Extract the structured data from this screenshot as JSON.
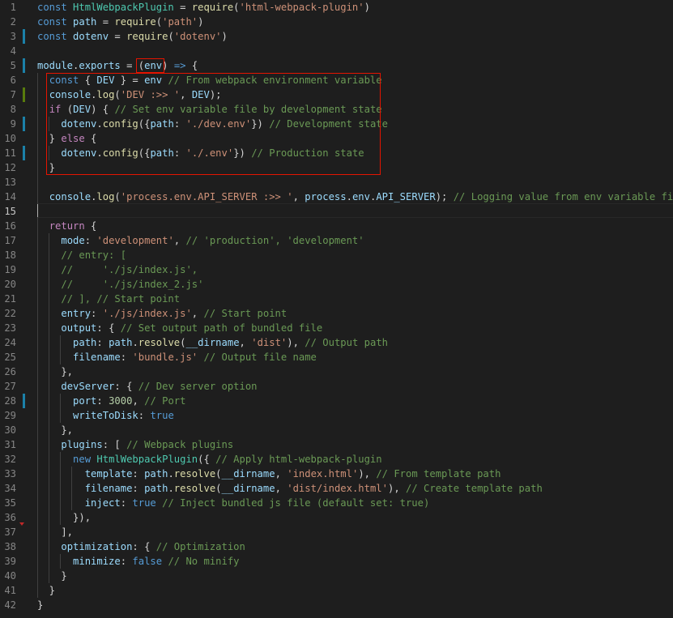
{
  "colors": {
    "background": "#1e1e1e",
    "line_number": "#858585",
    "keyword": "#569cd6",
    "control": "#c586c0",
    "variable": "#9cdcfe",
    "class": "#4ec9b0",
    "function": "#dcdcaa",
    "string": "#ce9178",
    "number": "#b5cea8",
    "comment": "#6a9955",
    "highlight_box": "#e51400",
    "gutter_modified": "#1b81a8",
    "gutter_added": "#587c0c"
  },
  "editor": {
    "active_line": 15,
    "lines": [
      {
        "n": "1",
        "tokens": [
          [
            "kw",
            "const"
          ],
          [
            "plain",
            " "
          ],
          [
            "cls",
            "HtmlWebpackPlugin"
          ],
          [
            "plain",
            " = "
          ],
          [
            "fn",
            "require"
          ],
          [
            "plain",
            "("
          ],
          [
            "str",
            "'html-webpack-plugin'"
          ],
          [
            "plain",
            ")"
          ]
        ]
      },
      {
        "n": "2",
        "tokens": [
          [
            "kw",
            "const"
          ],
          [
            "plain",
            " "
          ],
          [
            "var",
            "path"
          ],
          [
            "plain",
            " = "
          ],
          [
            "fn",
            "require"
          ],
          [
            "plain",
            "("
          ],
          [
            "str",
            "'path'"
          ],
          [
            "plain",
            ")"
          ]
        ]
      },
      {
        "n": "3",
        "gutter": "modified",
        "tokens": [
          [
            "kw",
            "const"
          ],
          [
            "plain",
            " "
          ],
          [
            "var",
            "dotenv"
          ],
          [
            "plain",
            " = "
          ],
          [
            "fn",
            "require"
          ],
          [
            "plain",
            "("
          ],
          [
            "str",
            "'dotenv'"
          ],
          [
            "plain",
            ")"
          ]
        ]
      },
      {
        "n": "4",
        "tokens": []
      },
      {
        "n": "5",
        "gutter": "modified",
        "tokens": [
          [
            "var",
            "module"
          ],
          [
            "plain",
            "."
          ],
          [
            "var",
            "exports"
          ],
          [
            "plain",
            " = "
          ],
          [
            "plain",
            "("
          ],
          [
            "var",
            "env"
          ],
          [
            "plain",
            ")"
          ],
          [
            "plain",
            " "
          ],
          [
            "kw",
            "=>"
          ],
          [
            "plain",
            " {"
          ]
        ]
      },
      {
        "n": "6",
        "tokens": [
          [
            "plain",
            "  "
          ],
          [
            "kw",
            "const"
          ],
          [
            "plain",
            " { "
          ],
          [
            "var",
            "DEV"
          ],
          [
            "plain",
            " } = "
          ],
          [
            "var",
            "env"
          ],
          [
            "plain",
            " "
          ],
          [
            "com",
            "// From webpack environment variable"
          ]
        ]
      },
      {
        "n": "7",
        "gutter": "added",
        "tokens": [
          [
            "plain",
            "  "
          ],
          [
            "var",
            "console"
          ],
          [
            "plain",
            "."
          ],
          [
            "fn",
            "log"
          ],
          [
            "plain",
            "("
          ],
          [
            "str",
            "'DEV :>> '"
          ],
          [
            "plain",
            ", "
          ],
          [
            "var",
            "DEV"
          ],
          [
            "plain",
            ");"
          ]
        ]
      },
      {
        "n": "8",
        "tokens": [
          [
            "plain",
            "  "
          ],
          [
            "ctl",
            "if"
          ],
          [
            "plain",
            " ("
          ],
          [
            "var",
            "DEV"
          ],
          [
            "plain",
            ") { "
          ],
          [
            "com",
            "// Set env variable file by development state"
          ]
        ]
      },
      {
        "n": "9",
        "gutter": "modified",
        "tokens": [
          [
            "plain",
            "    "
          ],
          [
            "var",
            "dotenv"
          ],
          [
            "plain",
            "."
          ],
          [
            "fn",
            "config"
          ],
          [
            "plain",
            "({"
          ],
          [
            "prop",
            "path"
          ],
          [
            "plain",
            ": "
          ],
          [
            "str",
            "'./dev.env'"
          ],
          [
            "plain",
            "}) "
          ],
          [
            "com",
            "// Development state"
          ]
        ]
      },
      {
        "n": "10",
        "tokens": [
          [
            "plain",
            "  } "
          ],
          [
            "ctl",
            "else"
          ],
          [
            "plain",
            " {"
          ]
        ]
      },
      {
        "n": "11",
        "gutter": "modified",
        "tokens": [
          [
            "plain",
            "    "
          ],
          [
            "var",
            "dotenv"
          ],
          [
            "plain",
            "."
          ],
          [
            "fn",
            "config"
          ],
          [
            "plain",
            "({"
          ],
          [
            "prop",
            "path"
          ],
          [
            "plain",
            ": "
          ],
          [
            "str",
            "'./.env'"
          ],
          [
            "plain",
            "}) "
          ],
          [
            "com",
            "// Production state"
          ]
        ]
      },
      {
        "n": "12",
        "tokens": [
          [
            "plain",
            "  }"
          ]
        ]
      },
      {
        "n": "13",
        "tokens": []
      },
      {
        "n": "14",
        "tokens": [
          [
            "plain",
            "  "
          ],
          [
            "var",
            "console"
          ],
          [
            "plain",
            "."
          ],
          [
            "fn",
            "log"
          ],
          [
            "plain",
            "("
          ],
          [
            "str",
            "'process.env.API_SERVER :>> '"
          ],
          [
            "plain",
            ", "
          ],
          [
            "var",
            "process"
          ],
          [
            "plain",
            "."
          ],
          [
            "var",
            "env"
          ],
          [
            "plain",
            "."
          ],
          [
            "var",
            "API_SERVER"
          ],
          [
            "plain",
            "); "
          ],
          [
            "com",
            "// Logging value from env variable file"
          ]
        ]
      },
      {
        "n": "15",
        "tokens": []
      },
      {
        "n": "16",
        "tokens": [
          [
            "plain",
            "  "
          ],
          [
            "ctl",
            "return"
          ],
          [
            "plain",
            " {"
          ]
        ]
      },
      {
        "n": "17",
        "tokens": [
          [
            "plain",
            "    "
          ],
          [
            "prop",
            "mode"
          ],
          [
            "plain",
            ": "
          ],
          [
            "str",
            "'development'"
          ],
          [
            "plain",
            ", "
          ],
          [
            "com",
            "// 'production', 'development'"
          ]
        ]
      },
      {
        "n": "18",
        "tokens": [
          [
            "plain",
            "    "
          ],
          [
            "com",
            "// entry: ["
          ]
        ]
      },
      {
        "n": "19",
        "tokens": [
          [
            "plain",
            "    "
          ],
          [
            "com",
            "//     './js/index.js',"
          ]
        ]
      },
      {
        "n": "20",
        "tokens": [
          [
            "plain",
            "    "
          ],
          [
            "com",
            "//     './js/index_2.js'"
          ]
        ]
      },
      {
        "n": "21",
        "tokens": [
          [
            "plain",
            "    "
          ],
          [
            "com",
            "// ], // Start point"
          ]
        ]
      },
      {
        "n": "22",
        "tokens": [
          [
            "plain",
            "    "
          ],
          [
            "prop",
            "entry"
          ],
          [
            "plain",
            ": "
          ],
          [
            "str",
            "'./js/index.js'"
          ],
          [
            "plain",
            ", "
          ],
          [
            "com",
            "// Start point"
          ]
        ]
      },
      {
        "n": "23",
        "tokens": [
          [
            "plain",
            "    "
          ],
          [
            "prop",
            "output"
          ],
          [
            "plain",
            ": { "
          ],
          [
            "com",
            "// Set output path of bundled file"
          ]
        ]
      },
      {
        "n": "24",
        "tokens": [
          [
            "plain",
            "      "
          ],
          [
            "prop",
            "path"
          ],
          [
            "plain",
            ": "
          ],
          [
            "var",
            "path"
          ],
          [
            "plain",
            "."
          ],
          [
            "fn",
            "resolve"
          ],
          [
            "plain",
            "("
          ],
          [
            "var",
            "__dirname"
          ],
          [
            "plain",
            ", "
          ],
          [
            "str",
            "'dist'"
          ],
          [
            "plain",
            "), "
          ],
          [
            "com",
            "// Output path"
          ]
        ]
      },
      {
        "n": "25",
        "tokens": [
          [
            "plain",
            "      "
          ],
          [
            "prop",
            "filename"
          ],
          [
            "plain",
            ": "
          ],
          [
            "str",
            "'bundle.js'"
          ],
          [
            "plain",
            " "
          ],
          [
            "com",
            "// Output file name"
          ]
        ]
      },
      {
        "n": "26",
        "tokens": [
          [
            "plain",
            "    },"
          ]
        ]
      },
      {
        "n": "27",
        "tokens": [
          [
            "plain",
            "    "
          ],
          [
            "prop",
            "devServer"
          ],
          [
            "plain",
            ": { "
          ],
          [
            "com",
            "// Dev server option"
          ]
        ]
      },
      {
        "n": "28",
        "gutter": "modified",
        "tokens": [
          [
            "plain",
            "      "
          ],
          [
            "prop",
            "port"
          ],
          [
            "plain",
            ": "
          ],
          [
            "num",
            "3000"
          ],
          [
            "plain",
            ", "
          ],
          [
            "com",
            "// Port"
          ]
        ]
      },
      {
        "n": "29",
        "tokens": [
          [
            "plain",
            "      "
          ],
          [
            "prop",
            "writeToDisk"
          ],
          [
            "plain",
            ": "
          ],
          [
            "kw",
            "true"
          ]
        ]
      },
      {
        "n": "30",
        "tokens": [
          [
            "plain",
            "    },"
          ]
        ]
      },
      {
        "n": "31",
        "tokens": [
          [
            "plain",
            "    "
          ],
          [
            "prop",
            "plugins"
          ],
          [
            "plain",
            ": [ "
          ],
          [
            "com",
            "// Webpack plugins"
          ]
        ]
      },
      {
        "n": "32",
        "tokens": [
          [
            "plain",
            "      "
          ],
          [
            "kw",
            "new"
          ],
          [
            "plain",
            " "
          ],
          [
            "cls",
            "HtmlWebpackPlugin"
          ],
          [
            "plain",
            "({ "
          ],
          [
            "com",
            "// Apply html-webpack-plugin"
          ]
        ]
      },
      {
        "n": "33",
        "tokens": [
          [
            "plain",
            "        "
          ],
          [
            "prop",
            "template"
          ],
          [
            "plain",
            ": "
          ],
          [
            "var",
            "path"
          ],
          [
            "plain",
            "."
          ],
          [
            "fn",
            "resolve"
          ],
          [
            "plain",
            "("
          ],
          [
            "var",
            "__dirname"
          ],
          [
            "plain",
            ", "
          ],
          [
            "str",
            "'index.html'"
          ],
          [
            "plain",
            "), "
          ],
          [
            "com",
            "// From template path"
          ]
        ]
      },
      {
        "n": "34",
        "tokens": [
          [
            "plain",
            "        "
          ],
          [
            "prop",
            "filename"
          ],
          [
            "plain",
            ": "
          ],
          [
            "var",
            "path"
          ],
          [
            "plain",
            "."
          ],
          [
            "fn",
            "resolve"
          ],
          [
            "plain",
            "("
          ],
          [
            "var",
            "__dirname"
          ],
          [
            "plain",
            ", "
          ],
          [
            "str",
            "'dist/index.html'"
          ],
          [
            "plain",
            "), "
          ],
          [
            "com",
            "// Create template path"
          ]
        ]
      },
      {
        "n": "35",
        "tokens": [
          [
            "plain",
            "        "
          ],
          [
            "prop",
            "inject"
          ],
          [
            "plain",
            ": "
          ],
          [
            "kw",
            "true"
          ],
          [
            "plain",
            " "
          ],
          [
            "com",
            "// Inject bundled js file (default set: true)"
          ]
        ]
      },
      {
        "n": "36",
        "tokens": [
          [
            "plain",
            "      }),"
          ]
        ]
      },
      {
        "n": "37",
        "tokens": [
          [
            "plain",
            "    ],"
          ]
        ]
      },
      {
        "n": "38",
        "tokens": [
          [
            "plain",
            "    "
          ],
          [
            "prop",
            "optimization"
          ],
          [
            "plain",
            ": { "
          ],
          [
            "com",
            "// Optimization"
          ]
        ]
      },
      {
        "n": "39",
        "tokens": [
          [
            "plain",
            "      "
          ],
          [
            "prop",
            "minimize"
          ],
          [
            "plain",
            ": "
          ],
          [
            "kw",
            "false"
          ],
          [
            "plain",
            " "
          ],
          [
            "com",
            "// No minify"
          ]
        ]
      },
      {
        "n": "40",
        "tokens": [
          [
            "plain",
            "    }"
          ]
        ]
      },
      {
        "n": "41",
        "tokens": [
          [
            "plain",
            "  }"
          ]
        ]
      },
      {
        "n": "42",
        "tokens": [
          [
            "plain",
            "}"
          ]
        ]
      }
    ]
  }
}
